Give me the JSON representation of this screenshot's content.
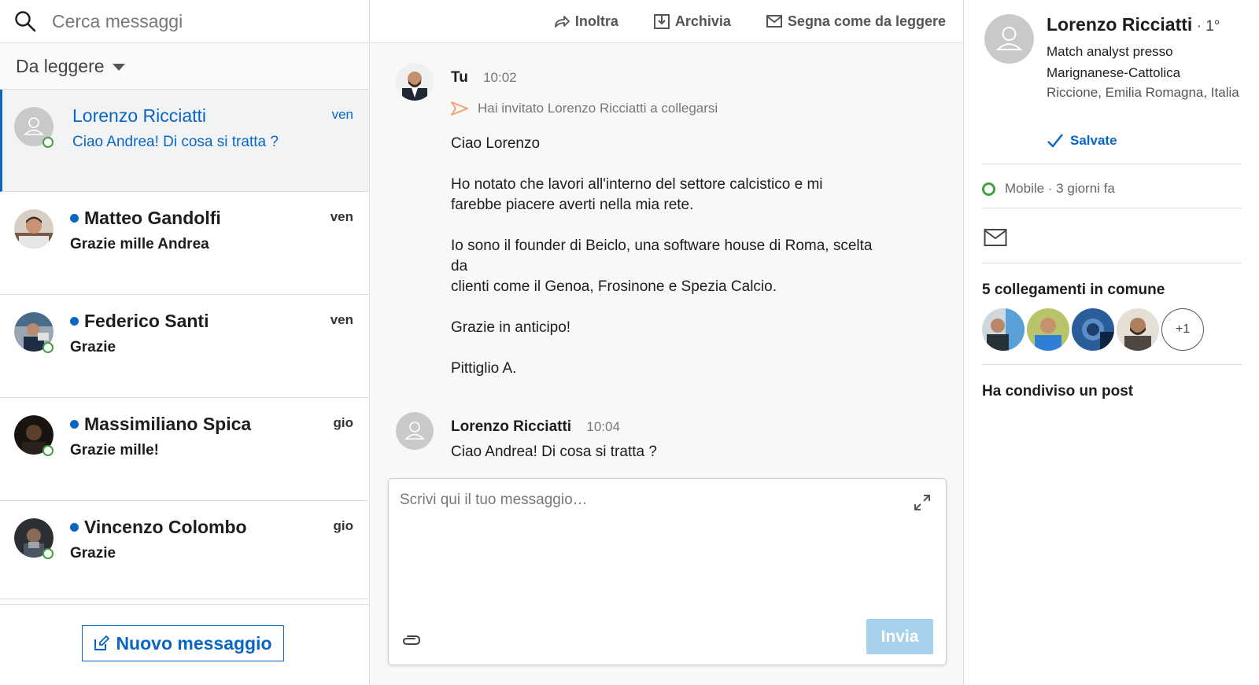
{
  "search": {
    "placeholder": "Cerca messaggi"
  },
  "filter": {
    "label": "Da leggere"
  },
  "conversations": [
    {
      "name": "Lorenzo Ricciatti",
      "snippet": "Ciao Andrea! Di cosa si tratta ?",
      "day": "ven",
      "active": true,
      "unread": false,
      "online": true
    },
    {
      "name": "Matteo Gandolfi",
      "snippet": "Grazie mille Andrea",
      "day": "ven",
      "active": false,
      "unread": true,
      "online": false
    },
    {
      "name": "Federico Santi",
      "snippet": "Grazie",
      "day": "ven",
      "active": false,
      "unread": true,
      "online": true
    },
    {
      "name": "Massimiliano Spica",
      "snippet": "Grazie mille!",
      "day": "gio",
      "active": false,
      "unread": true,
      "online": true
    },
    {
      "name": "Vincenzo Colombo",
      "snippet": "Grazie",
      "day": "gio",
      "active": false,
      "unread": true,
      "online": true
    }
  ],
  "new_message_label": "Nuovo messaggio",
  "toolbar": {
    "forward": "Inoltra",
    "archive": "Archivia",
    "mark_unread": "Segna come da leggere"
  },
  "messages": [
    {
      "sender": "Tu",
      "time": "10:02",
      "invite": "Hai invitato Lorenzo Ricciatti a collegarsi",
      "lines": [
        "Ciao Lorenzo",
        "",
        "Ho notato che lavori all'interno del settore calcistico e mi",
        "farebbe piacere averti nella mia rete.",
        "",
        "Io sono il founder di Beiclo, una software house di Roma, scelta",
        "da",
        "clienti come il Genoa, Frosinone e Spezia Calcio.",
        "",
        "Grazie in anticipo!",
        "",
        "Pittiglio A."
      ]
    },
    {
      "sender": "Lorenzo Ricciatti",
      "time": "10:04",
      "lines": [
        "Ciao Andrea! Di cosa si tratta ?"
      ]
    }
  ],
  "composer": {
    "placeholder": "Scrivi qui il tuo messaggio…",
    "send_label": "Invia"
  },
  "profile": {
    "name": "Lorenzo Ricciatti",
    "degree": " · 1°",
    "headline": "Match analyst presso Marignanese-Cattolica",
    "location": "Riccione, Emilia Romagna, Italia",
    "saved_label": "Salvate",
    "status": "Mobile · 3 giorni fa",
    "mutual_title": "5 collegamenti in comune",
    "mutual_more": "+1",
    "shared_post": "Ha condiviso un post"
  },
  "colors": {
    "accent": "#0a66c2",
    "online": "#3ea33e",
    "send_disabled": "#a8d1ee"
  }
}
